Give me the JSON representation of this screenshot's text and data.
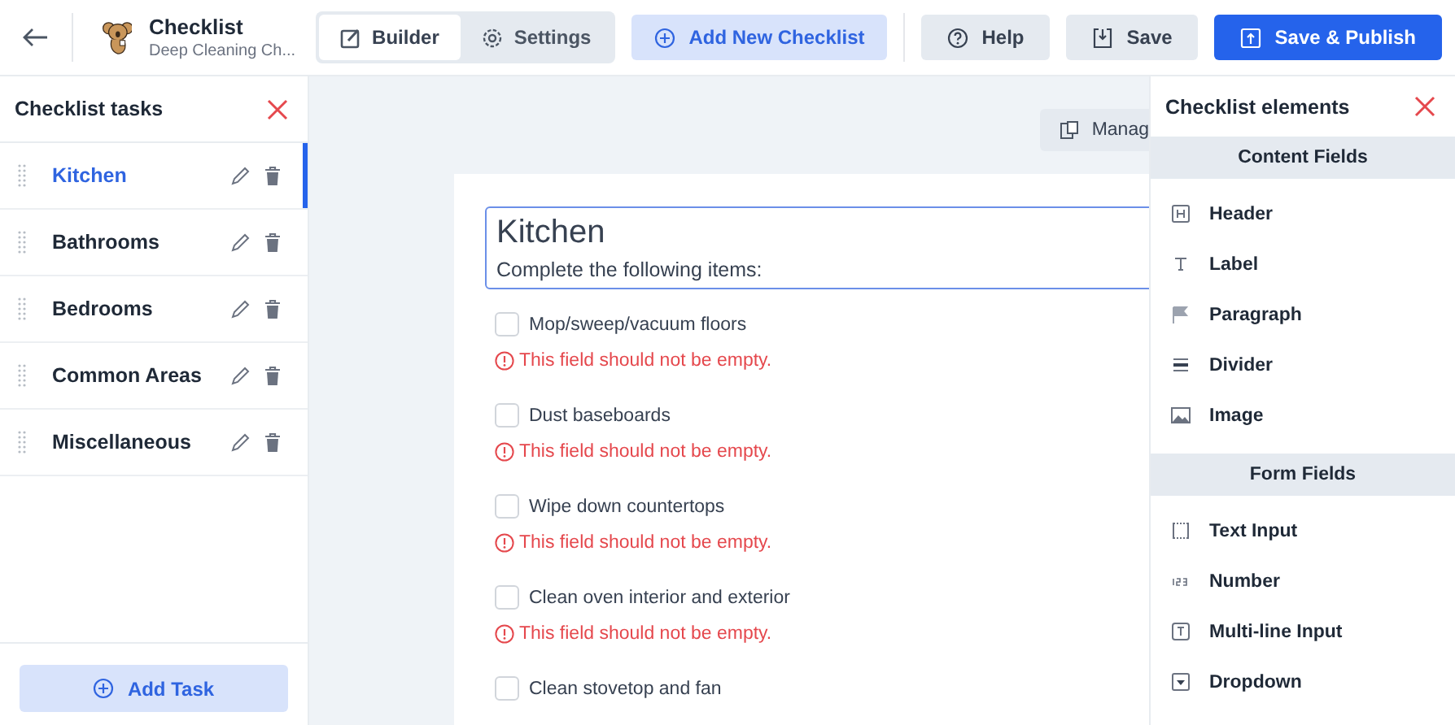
{
  "header": {
    "title": "Checklist",
    "subtitle": "Deep Cleaning Ch...",
    "tabs": [
      {
        "label": "Builder",
        "selected": true
      },
      {
        "label": "Settings",
        "selected": false
      }
    ],
    "actions": [
      {
        "label": "Add New Checklist",
        "kind": "accent"
      },
      {
        "label": "Help",
        "kind": "plain"
      },
      {
        "label": "Save",
        "kind": "plain"
      },
      {
        "label": "Save & Publish",
        "kind": "primary"
      }
    ]
  },
  "sidebar": {
    "title": "Checklist tasks",
    "tasks": [
      {
        "name": "Kitchen",
        "selected": true
      },
      {
        "name": "Bathrooms",
        "selected": false
      },
      {
        "name": "Bedrooms",
        "selected": false
      },
      {
        "name": "Common Areas",
        "selected": false
      },
      {
        "name": "Miscellaneous",
        "selected": false
      }
    ],
    "add_button": "Add Task"
  },
  "canvas": {
    "manage_button": "Manag",
    "form": {
      "title": "Kitchen",
      "subtitle": "Complete the following items:",
      "items": [
        {
          "label": "Mop/sweep/vacuum floors",
          "checked": false,
          "error": "This field should not be empty."
        },
        {
          "label": "Dust baseboards",
          "checked": false,
          "error": "This field should not be empty."
        },
        {
          "label": "Wipe down countertops",
          "checked": false,
          "error": "This field should not be empty."
        },
        {
          "label": "Clean oven interior and exterior",
          "checked": false,
          "error": "This field should not be empty."
        },
        {
          "label": "Clean stovetop and fan",
          "checked": false
        }
      ]
    }
  },
  "elements_panel": {
    "title": "Checklist elements",
    "sections": [
      {
        "heading": "Content Fields",
        "items": [
          {
            "label": "Header"
          },
          {
            "label": "Label"
          },
          {
            "label": "Paragraph"
          },
          {
            "label": "Divider"
          },
          {
            "label": "Image"
          }
        ]
      },
      {
        "heading": "Form Fields",
        "items": [
          {
            "label": "Text Input"
          },
          {
            "label": "Number"
          },
          {
            "label": "Multi-line Input"
          },
          {
            "label": "Dropdown"
          }
        ]
      }
    ]
  }
}
